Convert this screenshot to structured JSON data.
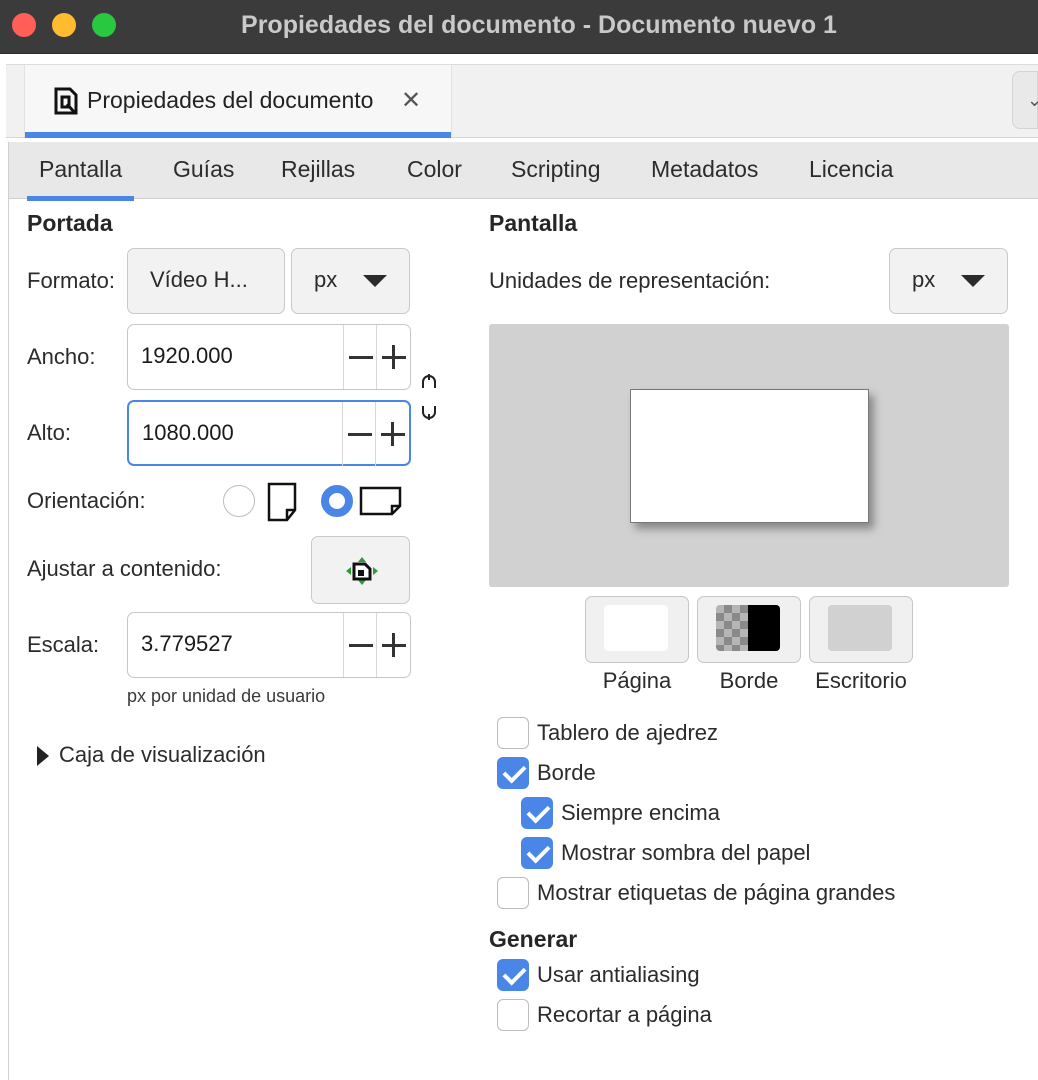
{
  "window": {
    "title": "Propiedades del documento - Documento nuevo 1"
  },
  "doc_tab": {
    "label": "Propiedades del documento",
    "close": "✕",
    "more": "⌄"
  },
  "tabs": [
    "Pantalla",
    "Guías",
    "Rejillas",
    "Color",
    "Scripting",
    "Metadatos",
    "Licencia"
  ],
  "active_tab": "Pantalla",
  "portada": {
    "heading": "Portada",
    "formato_label": "Formato:",
    "formato_value": "Vídeo H...",
    "unit_value": "px",
    "ancho_label": "Ancho:",
    "ancho_value": "1920.000",
    "alto_label": "Alto:",
    "alto_value": "1080.000",
    "orientacion_label": "Orientación:",
    "orientation_selected": "landscape",
    "ajustar_label": "Ajustar a contenido:",
    "escala_label": "Escala:",
    "escala_value": "3.779527",
    "escala_hint": "px por unidad de usuario",
    "caja_label": "Caja de visualización"
  },
  "pantalla": {
    "heading": "Pantalla",
    "unidades_label": "Unidades de representación:",
    "unidades_value": "px",
    "swatches": [
      {
        "label": "Página",
        "color": "#ffffff"
      },
      {
        "label": "Borde",
        "color": "#000000"
      },
      {
        "label": "Escritorio",
        "color": "#d1d1d1"
      }
    ],
    "checks": [
      {
        "label": "Tablero de ajedrez",
        "checked": false
      },
      {
        "label": "Borde",
        "checked": true
      },
      {
        "label": "Siempre encima",
        "checked": true
      },
      {
        "label": "Mostrar sombra del papel",
        "checked": true
      },
      {
        "label": "Mostrar etiquetas de página grandes",
        "checked": false
      }
    ]
  },
  "generar": {
    "heading": "Generar",
    "checks": [
      {
        "label": "Usar antialiasing",
        "checked": true
      },
      {
        "label": "Recortar a página",
        "checked": false
      }
    ]
  },
  "colors": {
    "accent": "#4a86e8",
    "titlebar": "#3c3b3b",
    "preview_bg": "#d1d1d1"
  }
}
